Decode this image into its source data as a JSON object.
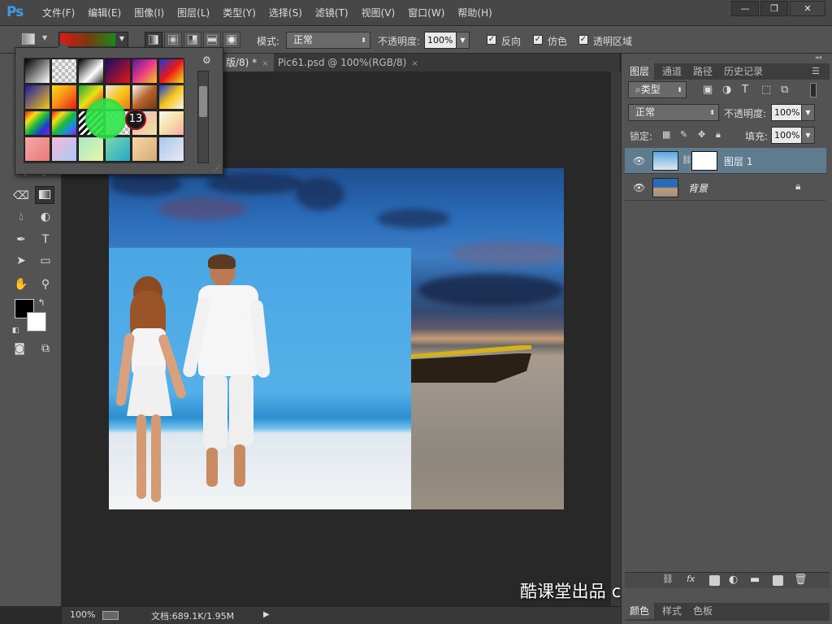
{
  "app": {
    "logo": "Ps"
  },
  "menu": [
    "文件(F)",
    "编辑(E)",
    "图像(I)",
    "图层(L)",
    "类型(Y)",
    "选择(S)",
    "滤镜(T)",
    "视图(V)",
    "窗口(W)",
    "帮助(H)"
  ],
  "window_controls": {
    "minimize": "—",
    "restore": "❐",
    "close": "✕"
  },
  "options": {
    "mode_label": "模式:",
    "mode_value": "正常",
    "opacity_label": "不透明度:",
    "opacity_value": "100%",
    "reverse_label": "反向",
    "dither_label": "仿色",
    "transparency_label": "透明区域",
    "reverse_checked": true,
    "dither_checked": true,
    "transparency_checked": true
  },
  "tabs": [
    {
      "label": "版/8) *",
      "active": true
    },
    {
      "label": "Pic61.psd @ 100%(RGB/8)",
      "active": false
    }
  ],
  "tab_close": "×",
  "status": {
    "zoom": "100%",
    "doc_info": "文档:689.1K/1.95M",
    "arrow": "▶"
  },
  "watermark": "酷课堂出品 coolketang.com",
  "gradient_picker": {
    "click_count": "13",
    "gradients": [
      "linear-gradient(135deg,#000,#fff)",
      "repeating-conic-gradient(#bbb 0 25%, #eee 0 50%) 0 0/8px 8px",
      "linear-gradient(135deg,#000,#fff 60%, transparent)",
      "linear-gradient(135deg,#1a0a6a,#e01818)",
      "linear-gradient(135deg,#5a1a9a,#e83a8a,#f6c618)",
      "linear-gradient(135deg,#1a3ad8,#e81818,#f6e018)",
      "linear-gradient(135deg,#1a1aa8,#f6c618)",
      "linear-gradient(135deg,#f6e018,#f68a18,#e81818)",
      "linear-gradient(135deg,#1aa83a,#e8e018,#e81818)",
      "linear-gradient(135deg,#e8e8e8,#f6c618,#e87818)",
      "linear-gradient(135deg,#f6f6f6,#b8622a,#6a3a1a)",
      "linear-gradient(135deg,#1a3ad8,#f6c618,#f6f6f6)",
      "linear-gradient(135deg,#e81818,#f6e018,#1ab83a,#1a3ad8,#9a1ad8)",
      "linear-gradient(135deg,#e81818,#f6e018,#1ab83a,#1a8ae8,#9a1ad8)",
      "repeating-linear-gradient(135deg,#111 0 3px,#f6f6f6 3px 6px)",
      "repeating-conic-gradient(#bbb 0 25%, #eee 0 50%) 0 0/8px 8px",
      "linear-gradient(135deg,#a8e8f6,#f6c6a8,#e8e8a8)",
      "linear-gradient(135deg,#f6f6f6,#f6e0a8,#f6a8a8)",
      "linear-gradient(135deg,#f6a8a8,#e87878)",
      "linear-gradient(135deg,#f6b8d8,#a8c8f6)",
      "linear-gradient(135deg,#a8e8c8,#e8f6a8)",
      "linear-gradient(135deg,#78d8a8,#28a8c8)",
      "linear-gradient(135deg,#f6d8a8,#d8a878)",
      "linear-gradient(135deg,#a8c8e8,#e8e8f6)"
    ]
  },
  "layers_panel": {
    "tabs": [
      "图层",
      "通道",
      "路径",
      "历史记录"
    ],
    "filter_label": "类型",
    "blend_mode": "正常",
    "opacity_label": "不透明度:",
    "opacity_value": "100%",
    "lock_label": "锁定:",
    "fill_label": "填充:",
    "fill_value": "100%",
    "layers": [
      {
        "name": "图层 1",
        "selected": true
      },
      {
        "name": "背景",
        "locked": true
      }
    ],
    "bottom_tabs": [
      "颜色",
      "样式",
      "色板"
    ]
  },
  "colors": {
    "accent": "#3d9ae8",
    "selected_layer": "#5f7b8e",
    "foreground": "#000000",
    "background": "#ffffff"
  }
}
